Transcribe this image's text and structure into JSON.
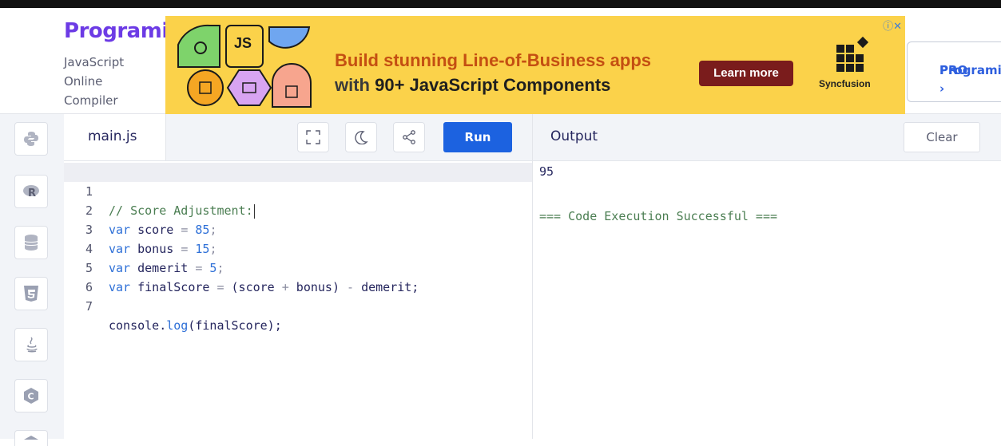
{
  "brand": {
    "logo_text": "rogramiz",
    "logo_letter": "P",
    "subtitle_lines": [
      "JavaScript",
      "Online",
      "Compiler"
    ]
  },
  "ad": {
    "line1": "Build stunning Line-of-Business apps",
    "line2_prefix": "with ",
    "line2_bold": "90+ JavaScript Components",
    "learn_more": "Learn more",
    "brand": "Syncfusion",
    "badge_js": "JS"
  },
  "pro_button": {
    "line1": "Programiz",
    "line2": "PRO ›"
  },
  "sidebar": {
    "items": [
      "python-icon",
      "r-icon",
      "sql-icon",
      "html5-icon",
      "java-icon",
      "c-icon",
      "more-icon"
    ]
  },
  "editor": {
    "file_tab": "main.js",
    "run_label": "Run",
    "lines": [
      {
        "n": "1"
      },
      {
        "n": "2"
      },
      {
        "n": "3"
      },
      {
        "n": "4"
      },
      {
        "n": "5"
      },
      {
        "n": "6"
      },
      {
        "n": "7"
      }
    ],
    "code": {
      "l1": "// Score Adjustment:",
      "l2_kw": "var",
      "l2_name": " score ",
      "l2_op": "=",
      "l2_num": " 85",
      "l2_end": ";",
      "l3_kw": "var",
      "l3_name": " bonus ",
      "l3_op": "=",
      "l3_num": " 15",
      "l3_end": ";",
      "l4_kw": "var",
      "l4_name": " demerit ",
      "l4_op": "=",
      "l4_num": " 5",
      "l4_end": ";",
      "l5_kw": "var",
      "l5_name": " finalScore ",
      "l5_op": "=",
      "l5_a": " (score ",
      "l5_plus": "+",
      "l5_b": " bonus) ",
      "l5_minus": "-",
      "l5_c": " demerit;",
      "l7_obj": "console.",
      "l7_fn": "log",
      "l7_args": "(finalScore);"
    }
  },
  "output": {
    "title": "Output",
    "clear_label": "Clear",
    "result": "95",
    "status": "=== Code Execution Successful ==="
  },
  "colors": {
    "accent": "#1c62e0",
    "brand": "#6c3be5",
    "ad_bg": "#fbd24a"
  }
}
